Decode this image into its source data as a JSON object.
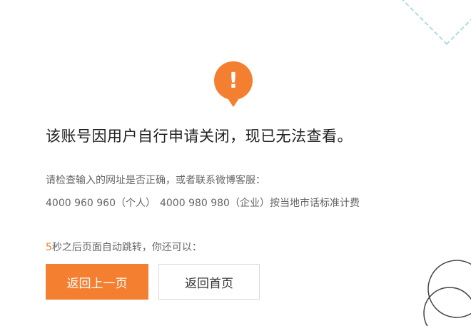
{
  "alert": {
    "icon": "exclamation-icon",
    "glyph": "!",
    "color": "#f47f31"
  },
  "message": {
    "title": "该账号因用户自行申请关闭，现已无法查看。",
    "hint": "请检查输入的网址是否正确，或者联系微博客服：",
    "hotline_personal": "4000 960 960（个人）",
    "hotline_business": "4000 980 980（企业）按当地市话标准计费"
  },
  "redirect": {
    "seconds": "5",
    "text": "秒之后页面自动跳转，你还可以："
  },
  "actions": {
    "back_label": "返回上一页",
    "home_label": "返回首页"
  },
  "colors": {
    "accent": "#f47f31",
    "text": "#333333",
    "muted": "#666666"
  }
}
